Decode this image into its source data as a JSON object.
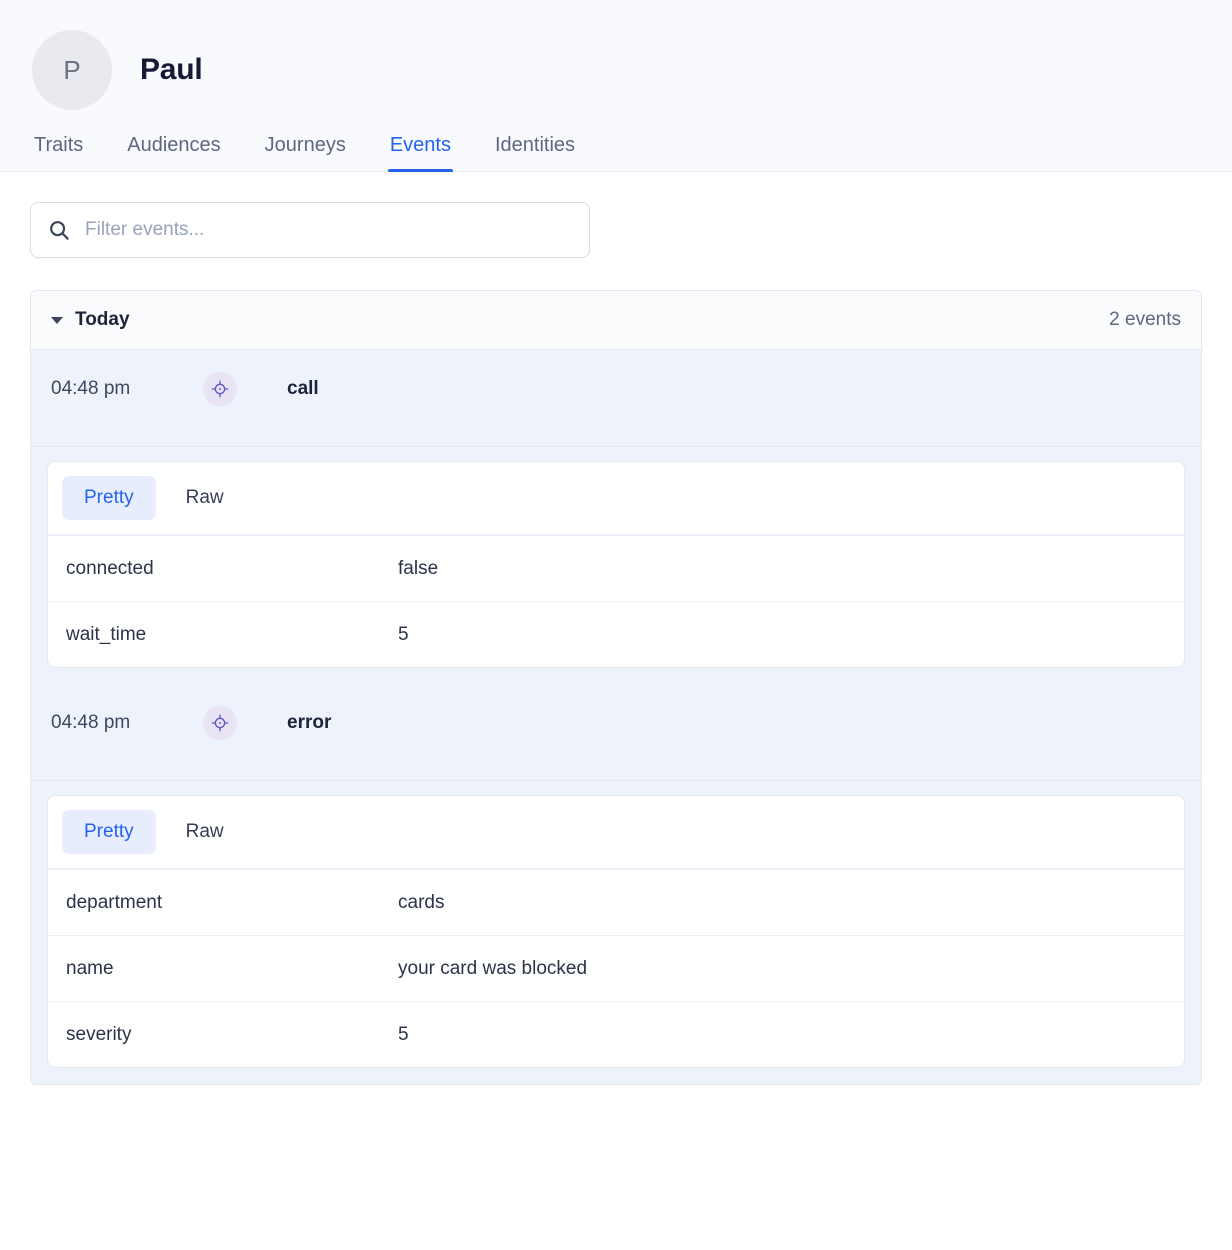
{
  "profile": {
    "avatar_initial": "P",
    "name": "Paul"
  },
  "tabs": [
    {
      "label": "Traits",
      "active": false
    },
    {
      "label": "Audiences",
      "active": false
    },
    {
      "label": "Journeys",
      "active": false
    },
    {
      "label": "Events",
      "active": true
    },
    {
      "label": "Identities",
      "active": false
    }
  ],
  "search": {
    "value": "",
    "placeholder": "Filter events...",
    "icon": "search-icon"
  },
  "group": {
    "title": "Today",
    "count_label": "2 events",
    "expanded": true,
    "caret_icon": "caret-down-icon"
  },
  "detail_tabs": {
    "pretty_label": "Pretty",
    "raw_label": "Raw",
    "active": "Pretty"
  },
  "colors": {
    "accent_blue": "#2563eb",
    "icon_purple": "#6355c4",
    "icon_bg": "#e8e4f5",
    "row_bg": "#eef2fb"
  },
  "events": [
    {
      "time": "04:48 pm",
      "name": "call",
      "icon": "crosshair-icon",
      "properties": [
        {
          "key": "connected",
          "value": "false"
        },
        {
          "key": "wait_time",
          "value": "5"
        }
      ]
    },
    {
      "time": "04:48 pm",
      "name": "error",
      "icon": "crosshair-icon",
      "properties": [
        {
          "key": "department",
          "value": "cards"
        },
        {
          "key": "name",
          "value": "your card was blocked"
        },
        {
          "key": "severity",
          "value": "5"
        }
      ]
    }
  ]
}
